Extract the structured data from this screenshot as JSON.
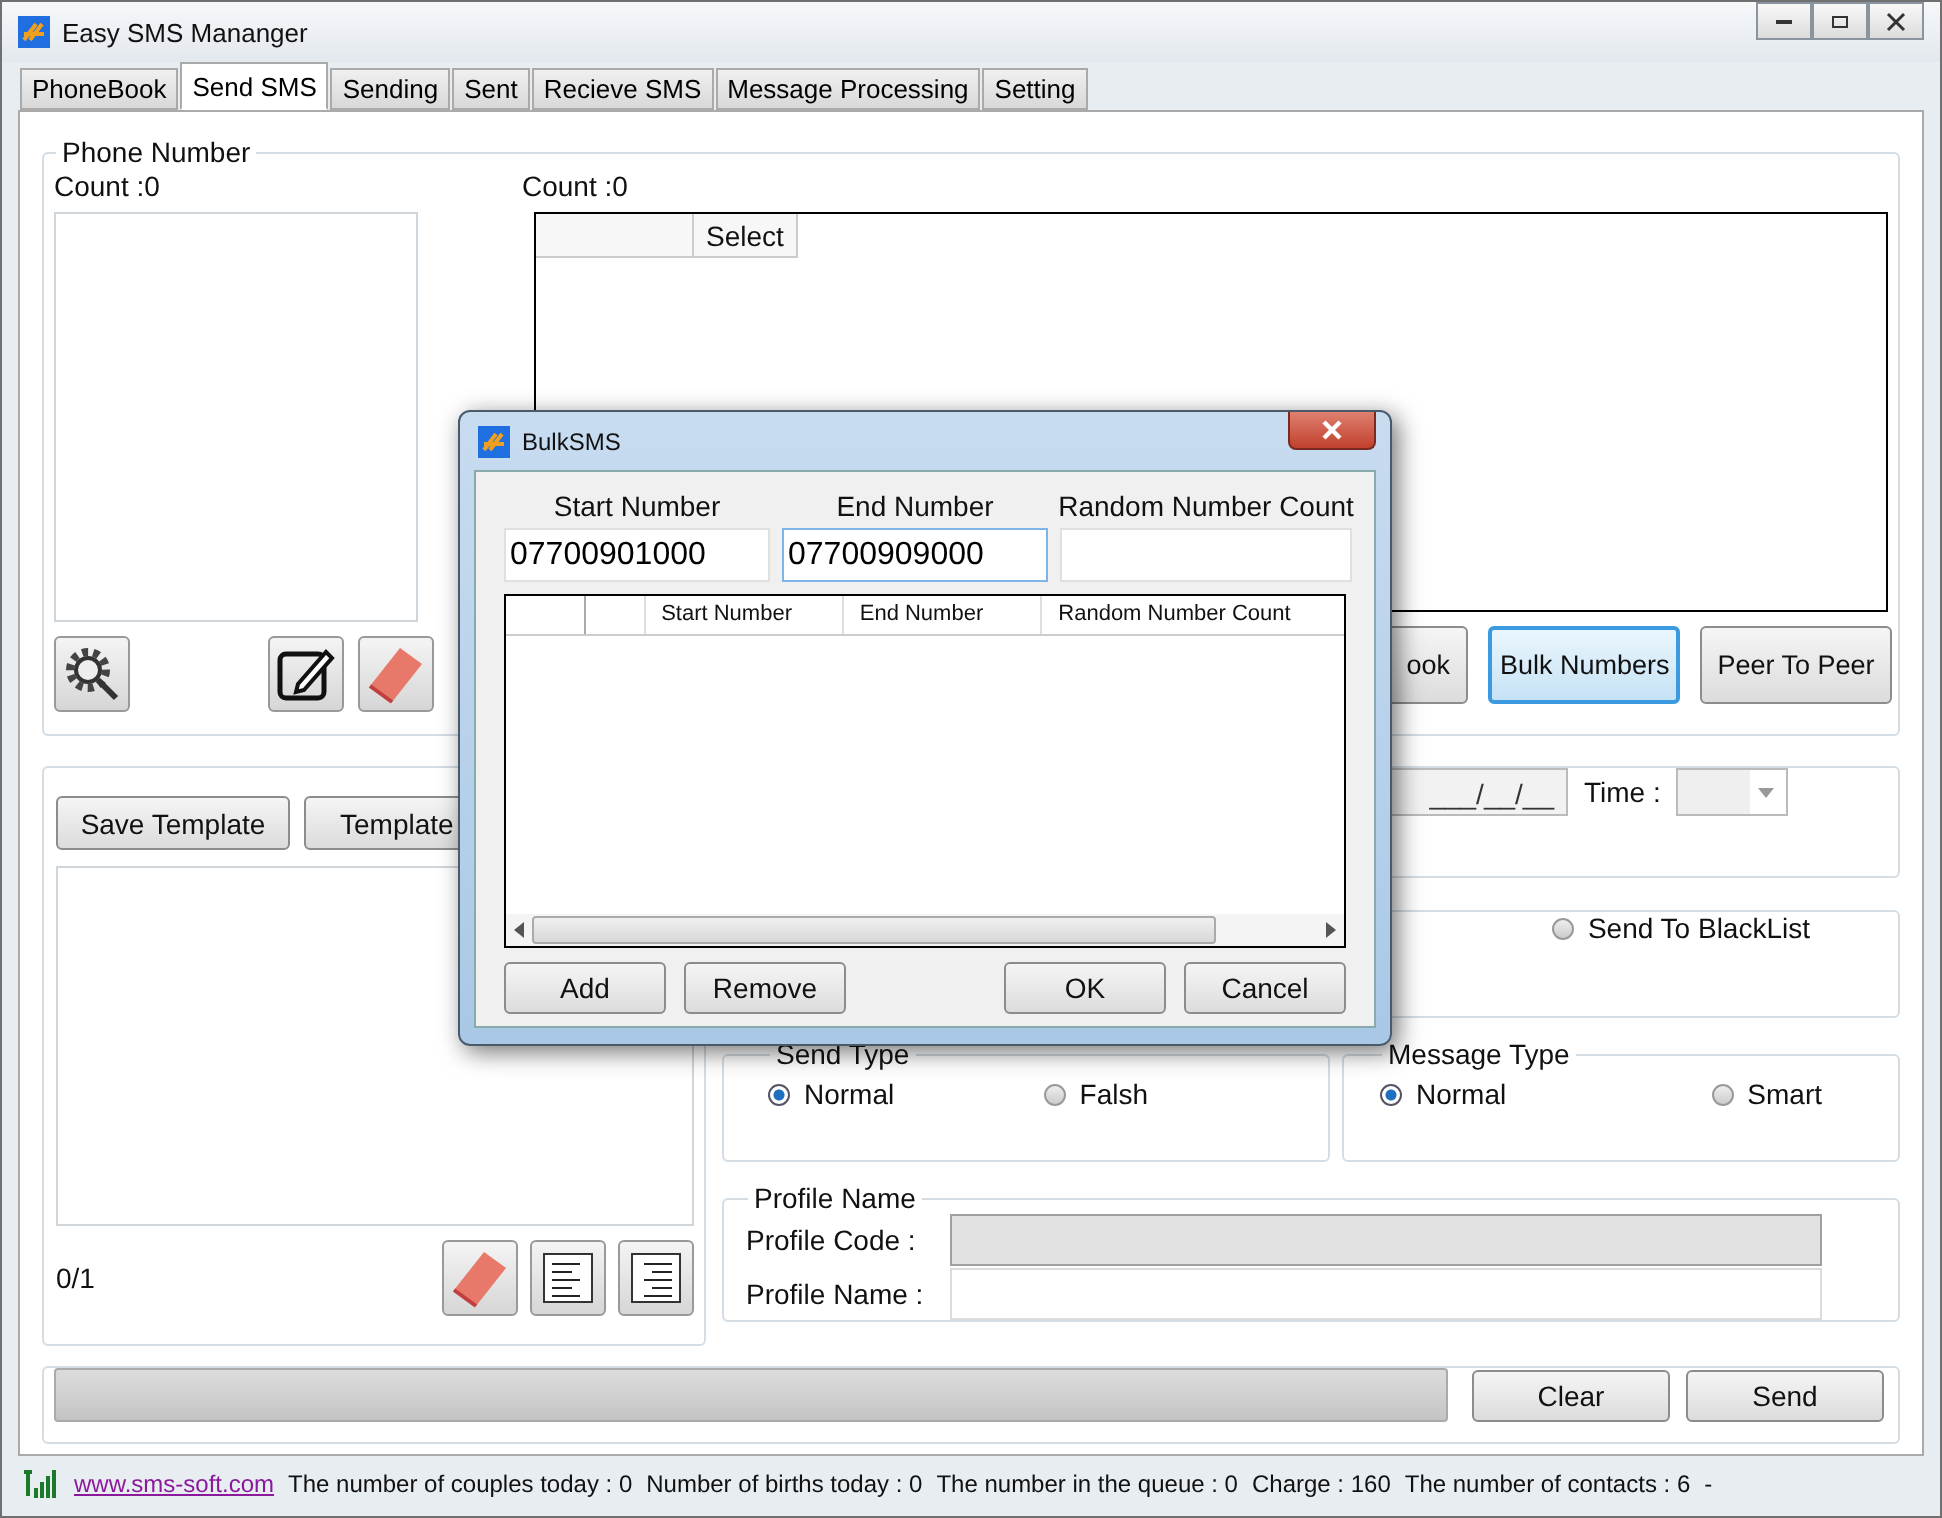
{
  "window": {
    "title": "Easy SMS Mananger"
  },
  "tabs": [
    {
      "label": "PhoneBook",
      "selected": false
    },
    {
      "label": "Send SMS",
      "selected": true
    },
    {
      "label": "Sending",
      "selected": false
    },
    {
      "label": "Sent",
      "selected": false
    },
    {
      "label": "Recieve SMS",
      "selected": false
    },
    {
      "label": "Message Processing",
      "selected": false
    },
    {
      "label": "Setting",
      "selected": false
    }
  ],
  "phone_number": {
    "title": "Phone Number",
    "left_count": "Count :0",
    "right_count": "Count :0",
    "grid_columns": [
      "Select"
    ],
    "tools": [
      {
        "kind": "search-gear"
      },
      {
        "kind": "edit"
      },
      {
        "kind": "eraser"
      }
    ],
    "buttons": [
      {
        "label": "ook",
        "focused": false
      },
      {
        "label": "Bulk Numbers",
        "focused": true
      },
      {
        "label": "Peer To Peer",
        "focused": false
      }
    ]
  },
  "template": {
    "buttons": [
      "Save Template",
      "Template"
    ],
    "counter": "0/1",
    "tools": [
      {
        "kind": "eraser"
      },
      {
        "kind": "align-left"
      },
      {
        "kind": "align-right"
      }
    ]
  },
  "schedule": {
    "date": "___/__/__",
    "time_label": "Time :"
  },
  "recipients": {
    "options": [
      {
        "label": "Send To BlackList",
        "selected": false
      }
    ]
  },
  "send_type": {
    "title": "Send Type",
    "options": [
      {
        "label": "Normal",
        "selected": true
      },
      {
        "label": "Falsh",
        "selected": false
      }
    ]
  },
  "message_type": {
    "title": "Message Type",
    "options": [
      {
        "label": "Normal",
        "selected": true
      },
      {
        "label": "Smart",
        "selected": false
      }
    ]
  },
  "profile": {
    "title": "Profile Name",
    "fields": [
      {
        "label": "Profile Code :",
        "disabled": true
      },
      {
        "label": "Profile Name :",
        "disabled": false
      }
    ]
  },
  "bottom": {
    "progress": {
      "level": 0
    },
    "buttons": [
      "Clear",
      "Send"
    ]
  },
  "status_bar": {
    "link": "www.sms-soft.com",
    "items": [
      "The number of couples today : 0",
      "Number of births today : 0",
      "The number in the queue : 0",
      "Charge : 160",
      "The number of contacts : 6",
      "-"
    ]
  },
  "dialog": {
    "title": "BulkSMS",
    "fields": [
      {
        "label": "Start Number",
        "value": "07700901000",
        "focused": false
      },
      {
        "label": "End Number",
        "value": "07700909000",
        "focused": true
      },
      {
        "label": "Random Number Count",
        "focused": false
      }
    ],
    "columns": [
      "Start Number",
      "End Number",
      "Random Number Count"
    ],
    "left_buttons": [
      "Add",
      "Remove"
    ],
    "right_buttons": [
      "OK",
      "Cancel"
    ]
  }
}
